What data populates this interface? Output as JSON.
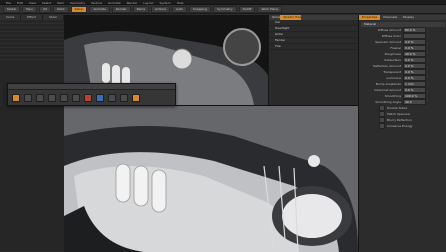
{
  "menubar": {
    "items": [
      "File",
      "Edit",
      "View",
      "Select",
      "Item",
      "Geometry",
      "Texture",
      "Animate",
      "Render",
      "Layout",
      "System",
      "Help"
    ]
  },
  "toolbar": {
    "buttons": [
      {
        "label": "Model",
        "active": false
      },
      {
        "label": "Topo",
        "active": false
      },
      {
        "label": "UV",
        "active": false
      },
      {
        "label": "Paint",
        "active": false
      },
      {
        "label": "Setup",
        "active": true
      },
      {
        "label": "Animate",
        "active": false
      },
      {
        "label": "Render",
        "active": false
      },
      {
        "label": "Items",
        "active": false
      },
      {
        "label": "Actions",
        "active": false
      },
      {
        "label": "Auto",
        "active": false
      },
      {
        "label": "Snapping",
        "active": false
      },
      {
        "label": "Symmetry",
        "active": false
      },
      {
        "label": "Falloff",
        "active": false
      },
      {
        "label": "Work Plane",
        "active": false
      }
    ]
  },
  "left_panel": {
    "tabs": [
      "Cams",
      "Effect",
      "Shad"
    ]
  },
  "item_list": {
    "tabs": [
      "Items",
      "Shader Tree"
    ],
    "rows": [
      "Car",
      "Headlight",
      "Grille",
      "Fender",
      "Tire"
    ]
  },
  "properties": {
    "tabs": [
      "Properties",
      "Channels",
      "Display"
    ],
    "header": "Material",
    "rows": [
      {
        "label": "Diffuse Amount",
        "value": "80.0 %"
      },
      {
        "label": "Diffuse Color",
        "value": ""
      },
      {
        "label": "Specular Amount",
        "value": "4.0 %"
      },
      {
        "label": "Fresnel",
        "value": "0.0 %"
      },
      {
        "label": "Roughness",
        "value": "40.0 %"
      },
      {
        "label": "Subsurface",
        "value": "0.0 %"
      },
      {
        "label": "Reflection Amount",
        "value": "0.0 %"
      },
      {
        "label": "Transparent",
        "value": "0.0 %"
      },
      {
        "label": "Luminous",
        "value": "0.0 %"
      },
      {
        "label": "Bump Amplitude",
        "value": "1 mm"
      },
      {
        "label": "Clearcoat Amount",
        "value": "0.0 %"
      },
      {
        "label": "Smoothing",
        "value": "100.0 %"
      },
      {
        "label": "Smoothing Angle",
        "value": "40.0"
      }
    ],
    "checks": [
      "Double Sided",
      "Match Specular",
      "Blurry Reflection",
      "Conserve Energy"
    ]
  },
  "palette": {
    "icons": [
      "select",
      "move",
      "rotate",
      "scale",
      "cut",
      "paint",
      "red",
      "blue",
      "grid",
      "lock",
      "sel"
    ]
  },
  "colors": {
    "accent": "#d78a2d",
    "panel": "#2c2c2c",
    "viewport": "#5f6166"
  }
}
